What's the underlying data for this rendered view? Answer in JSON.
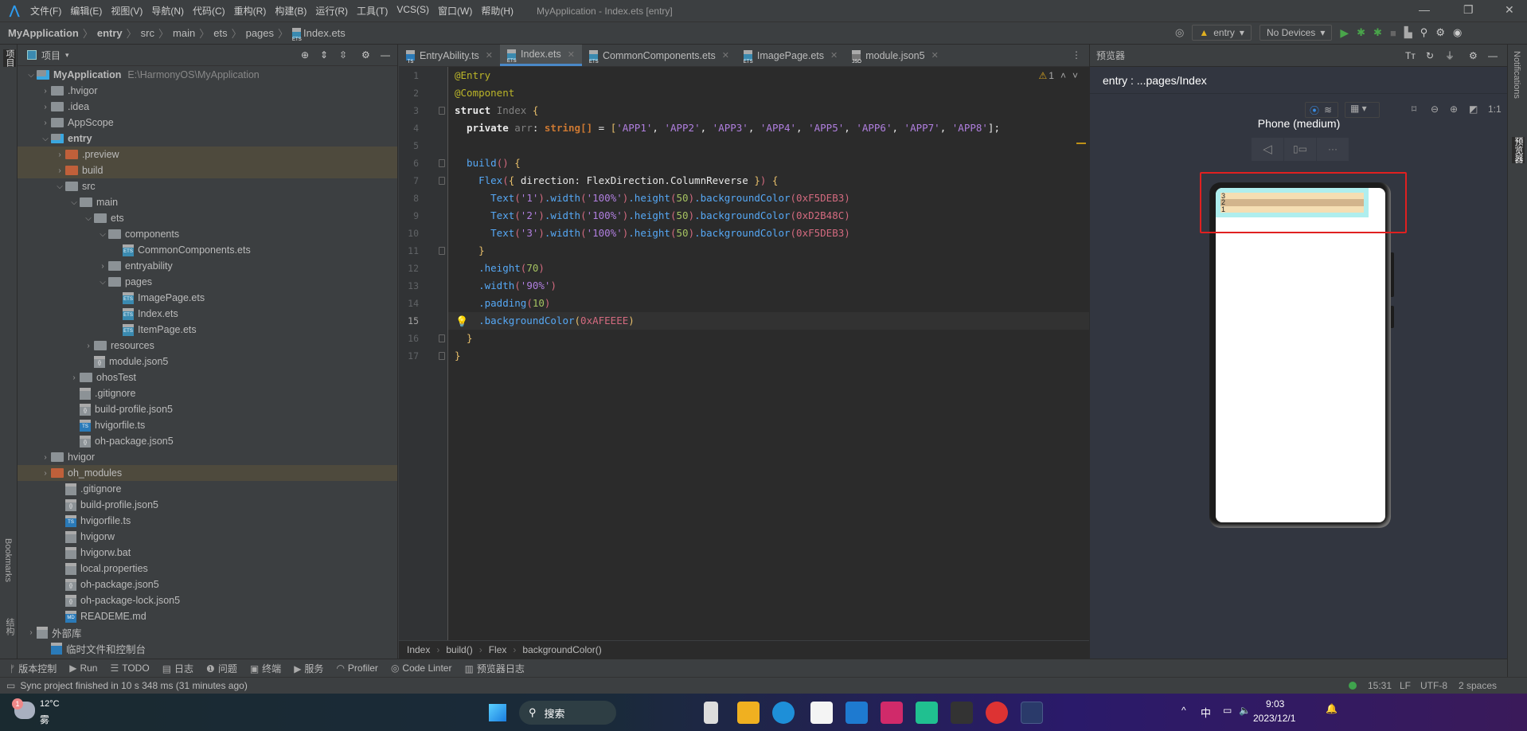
{
  "menubar": {
    "items": [
      "文件(F)",
      "编辑(E)",
      "视图(V)",
      "导航(N)",
      "代码(C)",
      "重构(R)",
      "构建(B)",
      "运行(R)",
      "工具(T)",
      "VCS(S)",
      "窗口(W)",
      "帮助(H)"
    ],
    "title": "MyApplication - Index.ets [entry]"
  },
  "navbar": {
    "crumbs": [
      "MyApplication",
      "entry",
      "src",
      "main",
      "ets",
      "pages",
      "Index.ets"
    ],
    "run_config": "entry",
    "device": "No Devices"
  },
  "left_strip": {
    "project": "项目",
    "bookmarks": "Bookmarks",
    "structure": "结构"
  },
  "project": {
    "title": "项目",
    "tree": [
      {
        "label": "MyApplication",
        "path": "E:\\HarmonyOS\\MyApplication",
        "depth": 0,
        "kind": "module",
        "open": true,
        "bold": true
      },
      {
        "label": ".hvigor",
        "depth": 1,
        "kind": "folder",
        "open": false
      },
      {
        "label": ".idea",
        "depth": 1,
        "kind": "folder",
        "open": false
      },
      {
        "label": "AppScope",
        "depth": 1,
        "kind": "folder",
        "open": false
      },
      {
        "label": "entry",
        "depth": 1,
        "kind": "module",
        "open": true,
        "bold": true
      },
      {
        "label": ".preview",
        "depth": 2,
        "kind": "excluded",
        "open": false,
        "highlight": true
      },
      {
        "label": "build",
        "depth": 2,
        "kind": "excluded",
        "open": false,
        "highlight": true
      },
      {
        "label": "src",
        "depth": 2,
        "kind": "folder",
        "open": true
      },
      {
        "label": "main",
        "depth": 3,
        "kind": "folder",
        "open": true
      },
      {
        "label": "ets",
        "depth": 4,
        "kind": "folder",
        "open": true
      },
      {
        "label": "components",
        "depth": 5,
        "kind": "folder",
        "open": true
      },
      {
        "label": "CommonComponents.ets",
        "depth": 6,
        "kind": "ets"
      },
      {
        "label": "entryability",
        "depth": 5,
        "kind": "folder",
        "open": false
      },
      {
        "label": "pages",
        "depth": 5,
        "kind": "folder",
        "open": true
      },
      {
        "label": "ImagePage.ets",
        "depth": 6,
        "kind": "ets"
      },
      {
        "label": "Index.ets",
        "depth": 6,
        "kind": "ets"
      },
      {
        "label": "ItemPage.ets",
        "depth": 6,
        "kind": "ets"
      },
      {
        "label": "resources",
        "depth": 4,
        "kind": "folder",
        "open": false
      },
      {
        "label": "module.json5",
        "depth": 4,
        "kind": "json"
      },
      {
        "label": "ohosTest",
        "depth": 3,
        "kind": "folder",
        "open": false
      },
      {
        "label": ".gitignore",
        "depth": 3,
        "kind": "file"
      },
      {
        "label": "build-profile.json5",
        "depth": 3,
        "kind": "json"
      },
      {
        "label": "hvigorfile.ts",
        "depth": 3,
        "kind": "ts"
      },
      {
        "label": "oh-package.json5",
        "depth": 3,
        "kind": "json"
      },
      {
        "label": "hvigor",
        "depth": 1,
        "kind": "folder",
        "open": false
      },
      {
        "label": "oh_modules",
        "depth": 1,
        "kind": "excluded",
        "open": false,
        "highlight": true
      },
      {
        "label": ".gitignore",
        "depth": 2,
        "kind": "file"
      },
      {
        "label": "build-profile.json5",
        "depth": 2,
        "kind": "json"
      },
      {
        "label": "hvigorfile.ts",
        "depth": 2,
        "kind": "ts"
      },
      {
        "label": "hvigorw",
        "depth": 2,
        "kind": "file"
      },
      {
        "label": "hvigorw.bat",
        "depth": 2,
        "kind": "file"
      },
      {
        "label": "local.properties",
        "depth": 2,
        "kind": "file"
      },
      {
        "label": "oh-package.json5",
        "depth": 2,
        "kind": "json"
      },
      {
        "label": "oh-package-lock.json5",
        "depth": 2,
        "kind": "json"
      },
      {
        "label": "READEME.md",
        "depth": 2,
        "kind": "md"
      },
      {
        "label": "外部库",
        "depth": 0,
        "kind": "lib",
        "open": false
      },
      {
        "label": "临时文件和控制台",
        "depth": 1,
        "kind": "console"
      }
    ]
  },
  "editor": {
    "tabs": [
      {
        "label": "EntryAbility.ts",
        "kind": "ts"
      },
      {
        "label": "Index.ets",
        "kind": "ets",
        "active": true
      },
      {
        "label": "CommonComponents.ets",
        "kind": "ets"
      },
      {
        "label": "ImagePage.ets",
        "kind": "ets"
      },
      {
        "label": "module.json5",
        "kind": "json"
      }
    ],
    "warning_count": "1",
    "current_line": 15,
    "lines": [
      [
        [
          "@Entry",
          "ann"
        ]
      ],
      [
        [
          "@Component",
          "ann"
        ]
      ],
      [
        [
          "struct ",
          "kwp"
        ],
        [
          "Index ",
          "type"
        ],
        [
          "{",
          "br"
        ]
      ],
      [
        [
          "  private ",
          "kwp"
        ],
        [
          "arr",
          "type"
        ],
        [
          ": ",
          "pl"
        ],
        [
          "string",
          "kw"
        ],
        [
          "[]",
          "kw"
        ],
        [
          " = ",
          "pl"
        ],
        [
          "[",
          "br"
        ],
        [
          "'APP1'",
          "str"
        ],
        [
          ", ",
          "pl"
        ],
        [
          "'APP2'",
          "str"
        ],
        [
          ", ",
          "pl"
        ],
        [
          "'APP3'",
          "str"
        ],
        [
          ", ",
          "pl"
        ],
        [
          "'APP4'",
          "str"
        ],
        [
          ", ",
          "pl"
        ],
        [
          "'APP5'",
          "str"
        ],
        [
          ", ",
          "pl"
        ],
        [
          "'APP6'",
          "str"
        ],
        [
          ", ",
          "pl"
        ],
        [
          "'APP7'",
          "str"
        ],
        [
          ", ",
          "pl"
        ],
        [
          "'APP8'",
          "str"
        ],
        [
          "];",
          "pl"
        ]
      ],
      [],
      [
        [
          "  build",
          "fn"
        ],
        [
          "() ",
          "paren"
        ],
        [
          "{",
          "br"
        ]
      ],
      [
        [
          "    Flex",
          "fn"
        ],
        [
          "(",
          "paren"
        ],
        [
          "{ ",
          "br"
        ],
        [
          "direction: FlexDirection.ColumnReverse ",
          "pl"
        ],
        [
          "}",
          "br"
        ],
        [
          ") ",
          "paren"
        ],
        [
          "{",
          "br"
        ]
      ],
      [
        [
          "      Text",
          "fn"
        ],
        [
          "(",
          "paren"
        ],
        [
          "'1'",
          "str"
        ],
        [
          ")",
          "paren"
        ],
        [
          ".width",
          "fn"
        ],
        [
          "(",
          "paren"
        ],
        [
          "'100%'",
          "str"
        ],
        [
          ")",
          "paren"
        ],
        [
          ".height",
          "fn"
        ],
        [
          "(",
          "paren"
        ],
        [
          "50",
          "numg"
        ],
        [
          ")",
          "paren"
        ],
        [
          ".backgroundColor",
          "fn"
        ],
        [
          "(",
          "paren"
        ],
        [
          "0xF5DEB3",
          "hex"
        ],
        [
          ")",
          "paren"
        ]
      ],
      [
        [
          "      Text",
          "fn"
        ],
        [
          "(",
          "paren"
        ],
        [
          "'2'",
          "str"
        ],
        [
          ")",
          "paren"
        ],
        [
          ".width",
          "fn"
        ],
        [
          "(",
          "paren"
        ],
        [
          "'100%'",
          "str"
        ],
        [
          ")",
          "paren"
        ],
        [
          ".height",
          "fn"
        ],
        [
          "(",
          "paren"
        ],
        [
          "50",
          "numg"
        ],
        [
          ")",
          "paren"
        ],
        [
          ".backgroundColor",
          "fn"
        ],
        [
          "(",
          "paren"
        ],
        [
          "0xD2B48C",
          "hex"
        ],
        [
          ")",
          "paren"
        ]
      ],
      [
        [
          "      Text",
          "fn"
        ],
        [
          "(",
          "paren"
        ],
        [
          "'3'",
          "str"
        ],
        [
          ")",
          "paren"
        ],
        [
          ".width",
          "fn"
        ],
        [
          "(",
          "paren"
        ],
        [
          "'100%'",
          "str"
        ],
        [
          ")",
          "paren"
        ],
        [
          ".height",
          "fn"
        ],
        [
          "(",
          "paren"
        ],
        [
          "50",
          "numg"
        ],
        [
          ")",
          "paren"
        ],
        [
          ".backgroundColor",
          "fn"
        ],
        [
          "(",
          "paren"
        ],
        [
          "0xF5DEB3",
          "hex"
        ],
        [
          ")",
          "paren"
        ]
      ],
      [
        [
          "    }",
          "br"
        ]
      ],
      [
        [
          "    .height",
          "fn"
        ],
        [
          "(",
          "paren"
        ],
        [
          "70",
          "numg"
        ],
        [
          ")",
          "paren"
        ]
      ],
      [
        [
          "    .width",
          "fn"
        ],
        [
          "(",
          "paren"
        ],
        [
          "'90%'",
          "str"
        ],
        [
          ")",
          "paren"
        ]
      ],
      [
        [
          "    .padding",
          "fn"
        ],
        [
          "(",
          "paren"
        ],
        [
          "10",
          "numg"
        ],
        [
          ")",
          "paren"
        ]
      ],
      [
        [
          "    .backgroundColor",
          "fn"
        ],
        [
          "(",
          "br"
        ],
        [
          "0xAFEEEE",
          "hex"
        ],
        [
          ")",
          "br"
        ]
      ],
      [
        [
          "  }",
          "br"
        ]
      ],
      [
        [
          "}",
          "br"
        ]
      ]
    ],
    "breadcrumb": [
      "Index",
      "build()",
      "Flex",
      "backgroundColor()"
    ]
  },
  "preview": {
    "title": "预览器",
    "path": "entry : ...pages/Index",
    "device_name": "Phone (medium)",
    "zoom_label": "1:1",
    "app": {
      "bg": "#AFEEEE",
      "items": [
        {
          "text": "3",
          "color": "#F5DEB3"
        },
        {
          "text": "2",
          "color": "#D2B48C"
        },
        {
          "text": "1",
          "color": "#F5DEB3"
        }
      ]
    }
  },
  "right_strip": {
    "notifications": "Notifications",
    "previewer": "预览器"
  },
  "toolwindows": [
    "版本控制",
    "Run",
    "TODO",
    "日志",
    "问题",
    "终端",
    "服务",
    "Profiler",
    "Code Linter",
    "预览器日志"
  ],
  "status": {
    "message": "Sync project finished in 10 s 348 ms (31 minutes ago)",
    "position": "15:31",
    "line_sep": "LF",
    "encoding": "UTF-8",
    "indent": "2 spaces"
  },
  "taskbar": {
    "weather_temp": "12°C",
    "weather_desc": "雾",
    "weather_badge": "1",
    "search": "搜索",
    "ime": "中",
    "time": "9:03",
    "date": "2023/12/1"
  }
}
